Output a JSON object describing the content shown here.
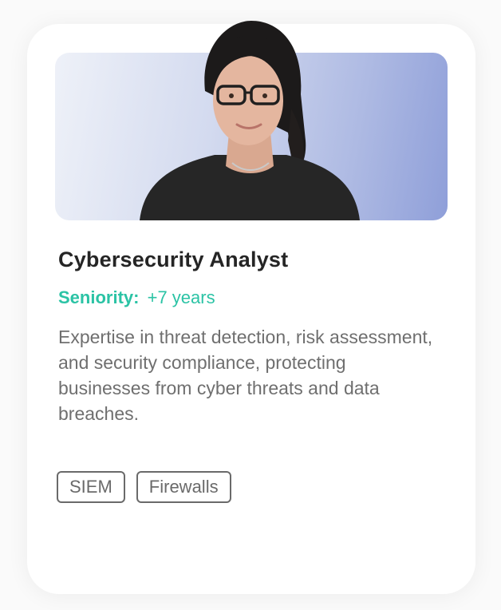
{
  "card": {
    "title": "Cybersecurity Analyst",
    "seniority_label": "Seniority:",
    "seniority_value": "+7 years",
    "description": "Expertise in threat detection, risk assessment, and security compliance, protecting businesses from cyber threats and data breaches.",
    "tags": [
      "SIEM",
      "Firewalls"
    ]
  },
  "colors": {
    "accent": "#2bc3a5",
    "title": "#252525",
    "text": "#6f6f6f",
    "tag_border": "#6a6a6a",
    "photo_bg_start": "#eef1f8",
    "photo_bg_end": "#8f9fd9"
  }
}
